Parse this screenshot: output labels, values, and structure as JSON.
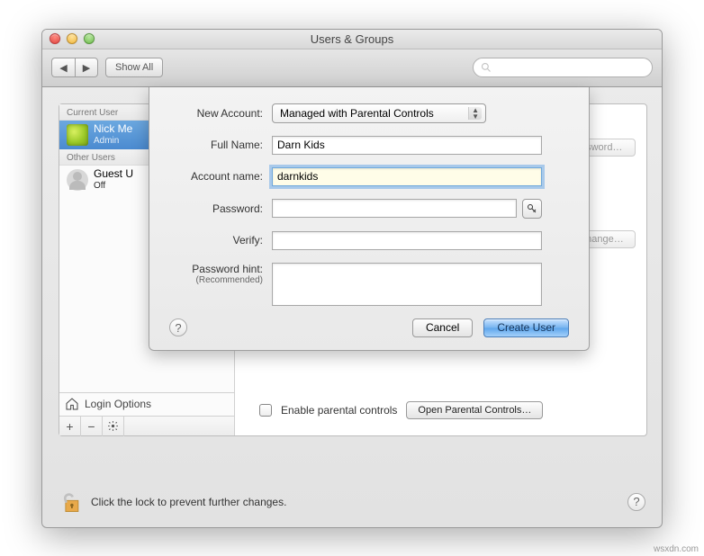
{
  "window": {
    "title": "Users & Groups"
  },
  "toolbar": {
    "show_all": "Show All",
    "search_placeholder": ""
  },
  "sidebar": {
    "current_header": "Current User",
    "other_header": "Other Users",
    "current": {
      "name": "Nick Me",
      "role": "Admin"
    },
    "other": {
      "name": "Guest U",
      "role": "Off"
    },
    "login_options": "Login Options"
  },
  "main": {
    "change_password": "Change Password…",
    "change": "Change…",
    "enable_parental": "Enable parental controls",
    "open_parental": "Open Parental Controls…"
  },
  "lock": {
    "text": "Click the lock to prevent further changes."
  },
  "sheet": {
    "labels": {
      "new_account": "New Account:",
      "full_name": "Full Name:",
      "account_name": "Account name:",
      "password": "Password:",
      "verify": "Verify:",
      "password_hint": "Password hint:",
      "recommended": "(Recommended)"
    },
    "values": {
      "account_type": "Managed with Parental Controls",
      "full_name": "Darn Kids",
      "account_name": "darnkids",
      "password": "",
      "verify": "",
      "hint": ""
    },
    "buttons": {
      "cancel": "Cancel",
      "create": "Create User"
    }
  },
  "watermark": "wsxdn.com"
}
